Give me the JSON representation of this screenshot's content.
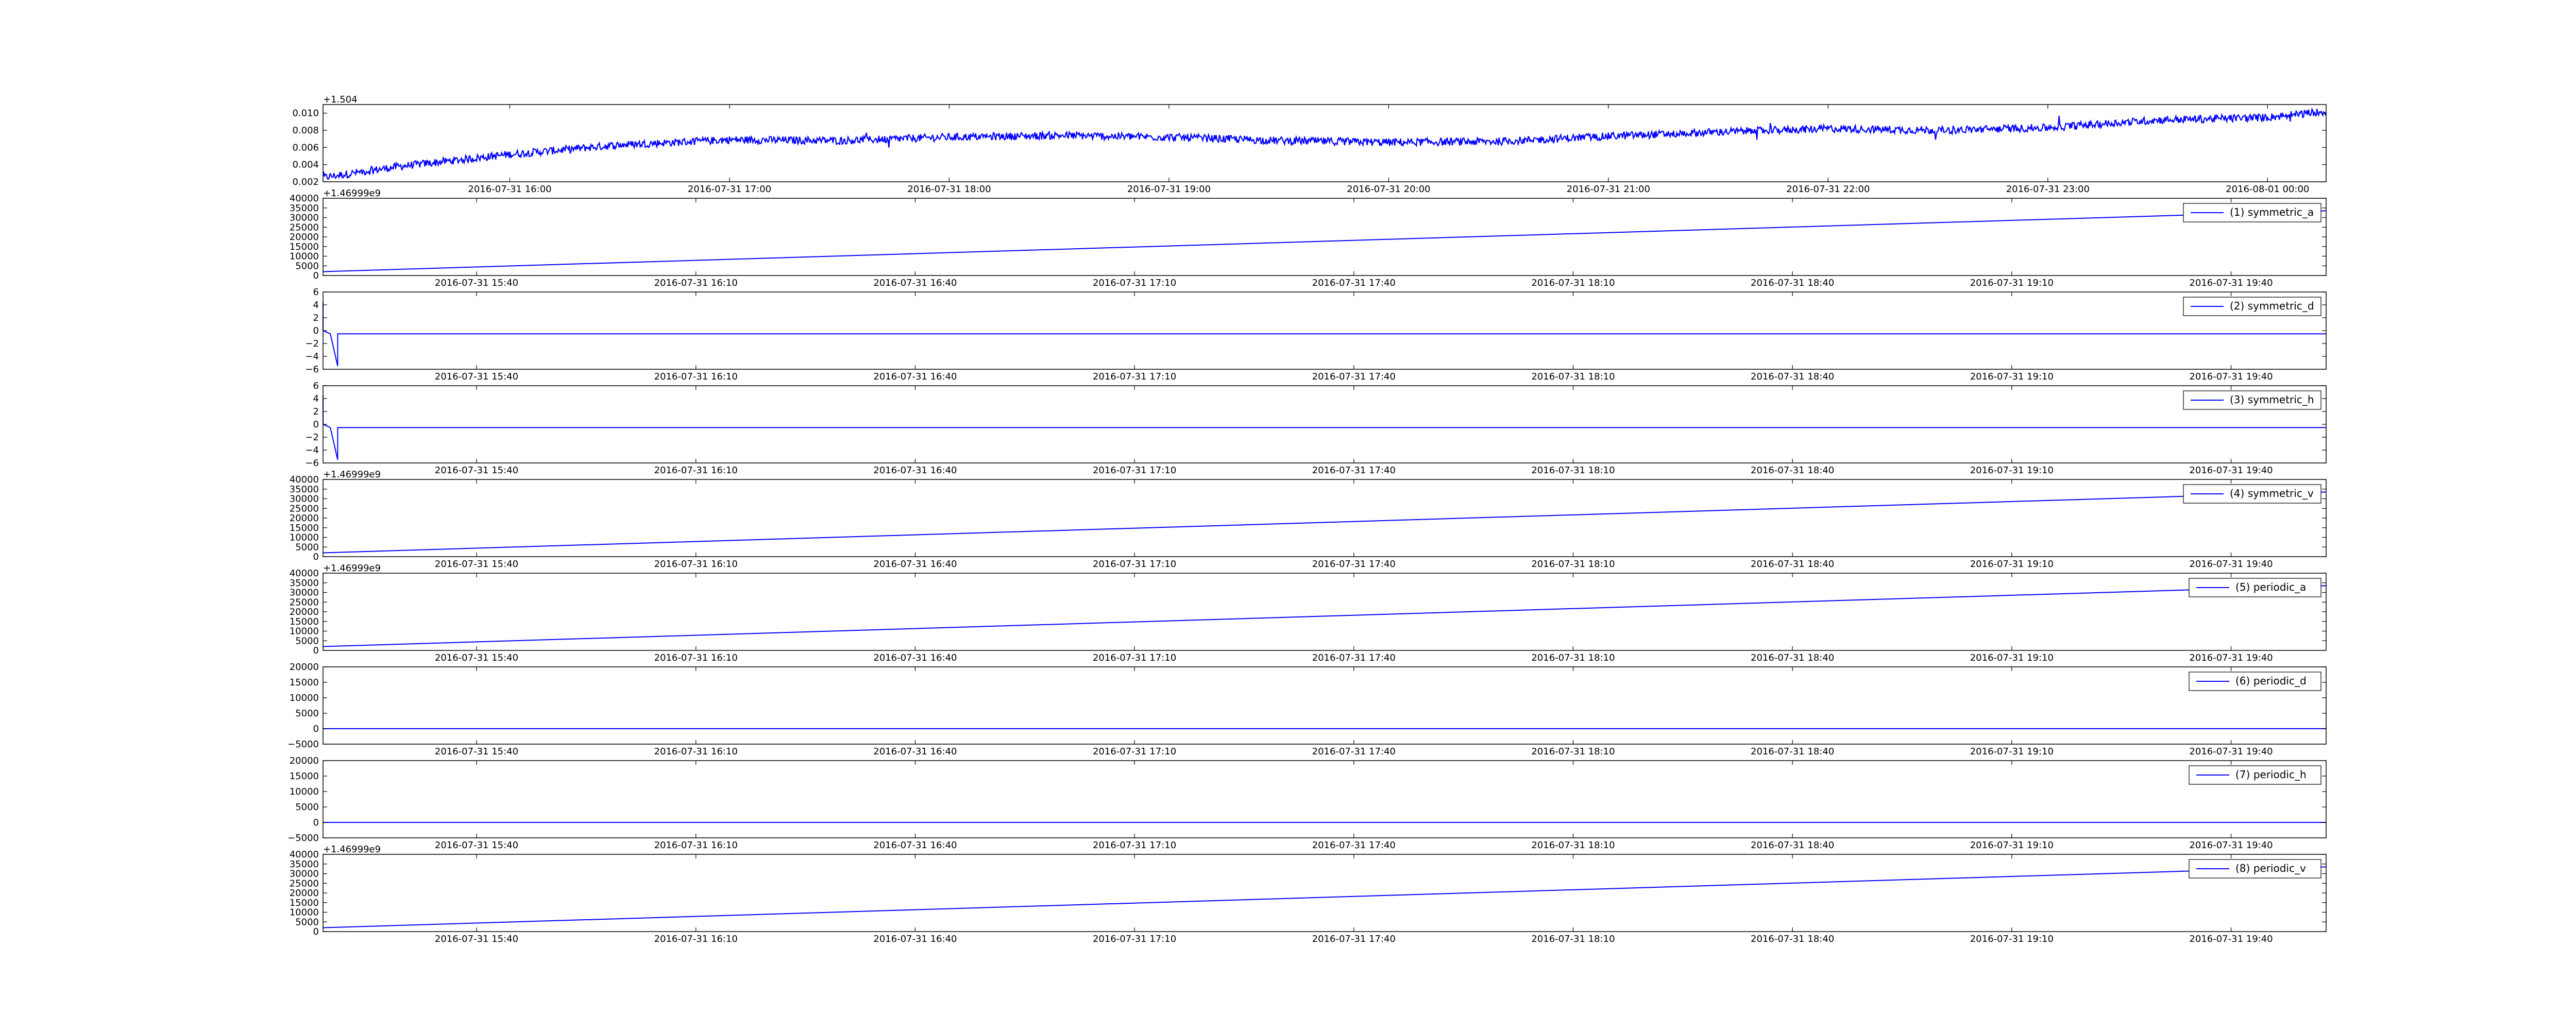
{
  "chart_data": [
    {
      "type": "line",
      "title": "",
      "offset_label": "+1.504",
      "x_ticks": [
        "2016-07-31 16:00",
        "2016-07-31 17:00",
        "2016-07-31 18:00",
        "2016-07-31 19:00",
        "2016-07-31 20:00",
        "2016-07-31 21:00",
        "2016-07-31 22:00",
        "2016-07-31 23:00",
        "2016-08-01 00:00"
      ],
      "xlim": [
        "2016-07-31 15:09",
        "2016-08-01 00:16"
      ],
      "ylim": [
        0.002,
        0.011
      ],
      "y_ticks": [
        "0.002",
        "0.004",
        "0.006",
        "0.008",
        "0.010"
      ],
      "line_color": "#0000ff",
      "noisy": true,
      "series": [
        {
          "x": [
            "2016-07-31 15:09",
            "2016-07-31 15:30",
            "2016-07-31 16:00",
            "2016-07-31 16:30",
            "2016-07-31 17:00",
            "2016-07-31 17:30",
            "2016-07-31 18:00",
            "2016-07-31 18:30",
            "2016-07-31 19:00",
            "2016-07-31 19:30",
            "2016-07-31 20:00",
            "2016-07-31 20:30",
            "2016-07-31 21:00",
            "2016-07-31 21:30",
            "2016-07-31 22:00",
            "2016-07-31 22:30",
            "2016-07-31 23:00",
            "2016-07-31 23:30",
            "2016-08-01 00:00",
            "2016-08-01 00:16"
          ],
          "y": [
            0.0025,
            0.0038,
            0.0052,
            0.0063,
            0.0069,
            0.0068,
            0.0072,
            0.0074,
            0.0072,
            0.0068,
            0.0066,
            0.0067,
            0.0073,
            0.0078,
            0.0082,
            0.008,
            0.0083,
            0.0092,
            0.0095,
            0.0102
          ]
        }
      ]
    },
    {
      "type": "line",
      "offset_label": "+1.46999e9",
      "x_ticks": [
        "2016-07-31 15:40",
        "2016-07-31 16:10",
        "2016-07-31 16:40",
        "2016-07-31 17:10",
        "2016-07-31 17:40",
        "2016-07-31 18:10",
        "2016-07-31 18:40",
        "2016-07-31 19:10",
        "2016-07-31 19:40"
      ],
      "xlim": [
        "2016-07-31 15:19",
        "2016-07-31 19:53"
      ],
      "ylim": [
        0,
        40000
      ],
      "y_ticks": [
        "0",
        "5000",
        "10000",
        "15000",
        "20000",
        "25000",
        "30000",
        "35000",
        "40000"
      ],
      "line_color": "#0000ff",
      "series": [
        {
          "name": "(1) symmetric_a",
          "x": [
            "2016-07-31 15:19",
            "2016-07-31 19:53"
          ],
          "y": [
            2000,
            33500
          ]
        }
      ]
    },
    {
      "type": "line",
      "offset_label": "",
      "x_ticks": [
        "2016-07-31 15:40",
        "2016-07-31 16:10",
        "2016-07-31 16:40",
        "2016-07-31 17:10",
        "2016-07-31 17:40",
        "2016-07-31 18:10",
        "2016-07-31 18:40",
        "2016-07-31 19:10",
        "2016-07-31 19:40"
      ],
      "xlim": [
        "2016-07-31 15:19",
        "2016-07-31 19:53"
      ],
      "ylim": [
        -6,
        6
      ],
      "y_ticks": [
        "−6",
        "−4",
        "−2",
        "0",
        "2",
        "4",
        "6"
      ],
      "line_color": "#0000ff",
      "series": [
        {
          "name": "(2) symmetric_d",
          "x": [
            "2016-07-31 15:19",
            "2016-07-31 15:19",
            "2016-07-31 15:20",
            "2016-07-31 15:21",
            "2016-07-31 15:21",
            "2016-07-31 19:53"
          ],
          "y": [
            4.5,
            0,
            -0.5,
            -5.5,
            -0.5,
            -0.5
          ]
        }
      ]
    },
    {
      "type": "line",
      "offset_label": "",
      "x_ticks": [
        "2016-07-31 15:40",
        "2016-07-31 16:10",
        "2016-07-31 16:40",
        "2016-07-31 17:10",
        "2016-07-31 17:40",
        "2016-07-31 18:10",
        "2016-07-31 18:40",
        "2016-07-31 19:10",
        "2016-07-31 19:40"
      ],
      "xlim": [
        "2016-07-31 15:19",
        "2016-07-31 19:53"
      ],
      "ylim": [
        -6,
        6
      ],
      "y_ticks": [
        "−6",
        "−4",
        "−2",
        "0",
        "2",
        "4",
        "6"
      ],
      "line_color": "#0000ff",
      "series": [
        {
          "name": "(3) symmetric_h",
          "x": [
            "2016-07-31 15:19",
            "2016-07-31 15:19",
            "2016-07-31 15:20",
            "2016-07-31 15:21",
            "2016-07-31 15:21",
            "2016-07-31 19:53"
          ],
          "y": [
            4.5,
            0,
            -0.5,
            -5.5,
            -0.5,
            -0.5
          ]
        }
      ]
    },
    {
      "type": "line",
      "offset_label": "+1.46999e9",
      "x_ticks": [
        "2016-07-31 15:40",
        "2016-07-31 16:10",
        "2016-07-31 16:40",
        "2016-07-31 17:10",
        "2016-07-31 17:40",
        "2016-07-31 18:10",
        "2016-07-31 18:40",
        "2016-07-31 19:10",
        "2016-07-31 19:40"
      ],
      "xlim": [
        "2016-07-31 15:19",
        "2016-07-31 19:53"
      ],
      "ylim": [
        0,
        40000
      ],
      "y_ticks": [
        "0",
        "5000",
        "10000",
        "15000",
        "20000",
        "25000",
        "30000",
        "35000",
        "40000"
      ],
      "line_color": "#0000ff",
      "series": [
        {
          "name": "(4) symmetric_v",
          "x": [
            "2016-07-31 15:19",
            "2016-07-31 19:53"
          ],
          "y": [
            2000,
            33500
          ]
        }
      ]
    },
    {
      "type": "line",
      "offset_label": "+1.46999e9",
      "x_ticks": [
        "2016-07-31 15:40",
        "2016-07-31 16:10",
        "2016-07-31 16:40",
        "2016-07-31 17:10",
        "2016-07-31 17:40",
        "2016-07-31 18:10",
        "2016-07-31 18:40",
        "2016-07-31 19:10",
        "2016-07-31 19:40"
      ],
      "xlim": [
        "2016-07-31 15:19",
        "2016-07-31 19:53"
      ],
      "ylim": [
        0,
        40000
      ],
      "y_ticks": [
        "0",
        "5000",
        "10000",
        "15000",
        "20000",
        "25000",
        "30000",
        "35000",
        "40000"
      ],
      "line_color": "#0000ff",
      "series": [
        {
          "name": "(5) periodic_a",
          "x": [
            "2016-07-31 15:19",
            "2016-07-31 19:53"
          ],
          "y": [
            2000,
            33500
          ]
        }
      ]
    },
    {
      "type": "line",
      "offset_label": "",
      "x_ticks": [
        "2016-07-31 15:40",
        "2016-07-31 16:10",
        "2016-07-31 16:40",
        "2016-07-31 17:10",
        "2016-07-31 17:40",
        "2016-07-31 18:10",
        "2016-07-31 18:40",
        "2016-07-31 19:10",
        "2016-07-31 19:40"
      ],
      "xlim": [
        "2016-07-31 15:19",
        "2016-07-31 19:53"
      ],
      "ylim": [
        -5000,
        20000
      ],
      "y_ticks": [
        "−5000",
        "0",
        "5000",
        "10000",
        "15000",
        "20000"
      ],
      "line_color": "#0000ff",
      "series": [
        {
          "name": "(6) periodic_d",
          "x": [
            "2016-07-31 15:19",
            "2016-07-31 19:53"
          ],
          "y": [
            0,
            0
          ]
        }
      ]
    },
    {
      "type": "line",
      "offset_label": "",
      "x_ticks": [
        "2016-07-31 15:40",
        "2016-07-31 16:10",
        "2016-07-31 16:40",
        "2016-07-31 17:10",
        "2016-07-31 17:40",
        "2016-07-31 18:10",
        "2016-07-31 18:40",
        "2016-07-31 19:10",
        "2016-07-31 19:40"
      ],
      "xlim": [
        "2016-07-31 15:19",
        "2016-07-31 19:53"
      ],
      "ylim": [
        -5000,
        20000
      ],
      "y_ticks": [
        "−5000",
        "0",
        "5000",
        "10000",
        "15000",
        "20000"
      ],
      "line_color": "#0000ff",
      "series": [
        {
          "name": "(7) periodic_h",
          "x": [
            "2016-07-31 15:19",
            "2016-07-31 19:53"
          ],
          "y": [
            0,
            0
          ]
        }
      ]
    },
    {
      "type": "line",
      "offset_label": "+1.46999e9",
      "x_ticks": [
        "2016-07-31 15:40",
        "2016-07-31 16:10",
        "2016-07-31 16:40",
        "2016-07-31 17:10",
        "2016-07-31 17:40",
        "2016-07-31 18:10",
        "2016-07-31 18:40",
        "2016-07-31 19:10",
        "2016-07-31 19:40"
      ],
      "xlim": [
        "2016-07-31 15:19",
        "2016-07-31 19:53"
      ],
      "ylim": [
        0,
        40000
      ],
      "y_ticks": [
        "0",
        "5000",
        "10000",
        "15000",
        "20000",
        "25000",
        "30000",
        "35000",
        "40000"
      ],
      "line_color": "#0000ff",
      "series": [
        {
          "name": "(8) periodic_v",
          "x": [
            "2016-07-31 15:19",
            "2016-07-31 19:53"
          ],
          "y": [
            2000,
            33500
          ]
        }
      ]
    }
  ]
}
